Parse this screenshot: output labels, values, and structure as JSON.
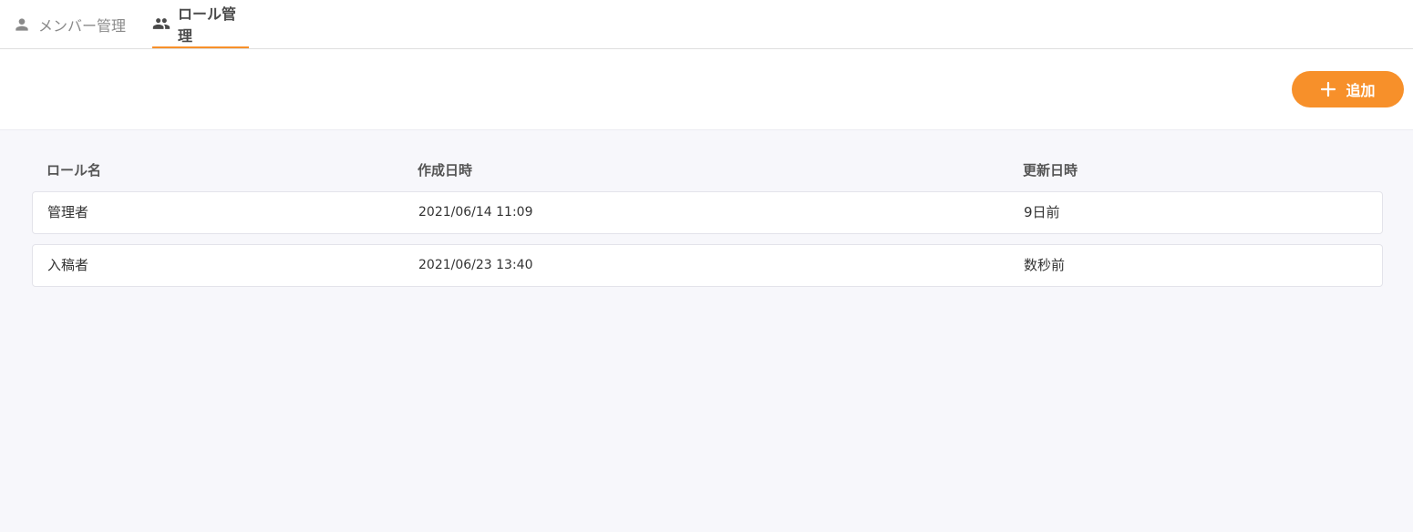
{
  "tabs": [
    {
      "label": "メンバー管理",
      "icon": "person-icon",
      "active": false
    },
    {
      "label": "ロール管理",
      "icon": "group-icon",
      "active": true
    }
  ],
  "toolbar": {
    "add_label": "追加",
    "accent": "#f7902a"
  },
  "table": {
    "headers": [
      "ロール名",
      "作成日時",
      "更新日時"
    ],
    "rows": [
      {
        "name": "管理者",
        "created": "2021/06/14 11:09",
        "updated": "9日前"
      },
      {
        "name": "入稿者",
        "created": "2021/06/23 13:40",
        "updated": "数秒前"
      }
    ]
  }
}
